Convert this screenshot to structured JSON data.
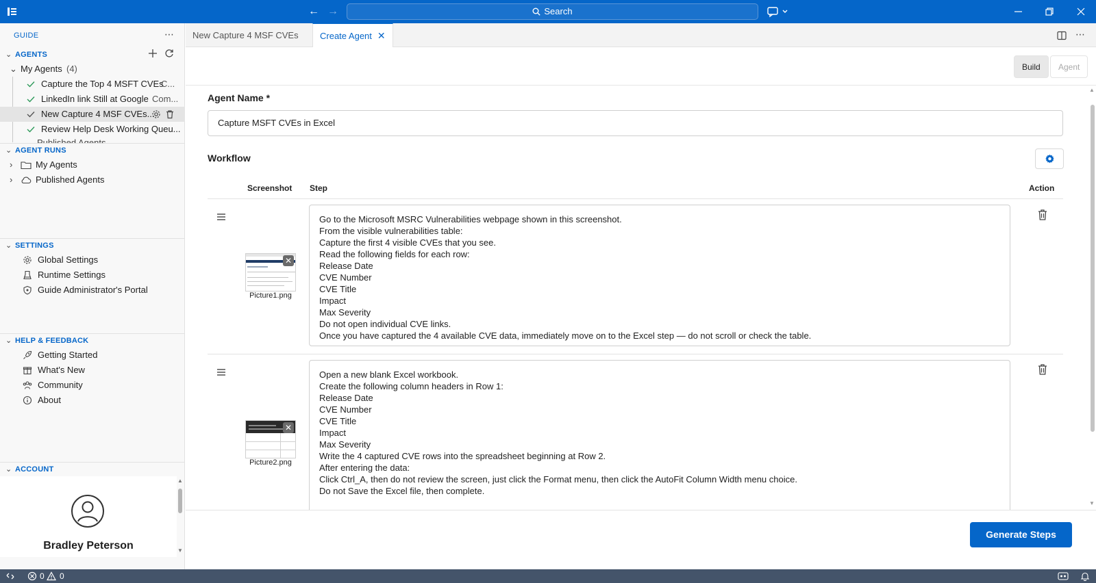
{
  "titlebar": {
    "search_label": "Search"
  },
  "sidebar": {
    "header": "GUIDE",
    "agents": {
      "title": "AGENTS",
      "my_agents_label": "My Agents",
      "my_agents_count": "(4)",
      "items": [
        {
          "label": "Capture the Top 4 MSFT CVEs",
          "suffix": "C..."
        },
        {
          "label": "LinkedIn link Still at Google",
          "suffix": "Com..."
        },
        {
          "label": "New Capture 4 MSF CVEs..."
        },
        {
          "label": "Review Help Desk Working Queu..."
        }
      ],
      "published_partial": "Published Agents"
    },
    "agent_runs": {
      "title": "AGENT RUNS",
      "items": [
        {
          "label": "My Agents"
        },
        {
          "label": "Published Agents"
        }
      ]
    },
    "settings": {
      "title": "SETTINGS",
      "items": [
        {
          "label": "Global Settings"
        },
        {
          "label": "Runtime Settings"
        },
        {
          "label": "Guide Administrator's Portal"
        }
      ]
    },
    "help": {
      "title": "HELP & FEEDBACK",
      "items": [
        {
          "label": "Getting Started"
        },
        {
          "label": "What's New"
        },
        {
          "label": "Community"
        },
        {
          "label": "About"
        }
      ]
    },
    "account": {
      "title": "ACCOUNT",
      "user_name": "Bradley Peterson"
    }
  },
  "tabs": [
    {
      "label": "New Capture 4 MSF CVEs"
    },
    {
      "label": "Create Agent"
    }
  ],
  "main": {
    "mode_build": "Build",
    "mode_agent": "Agent",
    "agent_name_label": "Agent Name *",
    "agent_name_value": "Capture MSFT CVEs in Excel",
    "workflow_label": "Workflow",
    "columns": {
      "screenshot": "Screenshot",
      "step": "Step",
      "action": "Action"
    },
    "steps": [
      {
        "screenshot": "Picture1.png",
        "text": "Go to the Microsoft MSRC Vulnerabilities webpage shown in this screenshot.\nFrom the visible vulnerabilities table:\nCapture the first 4 visible CVEs that you see.\nRead the following fields for each row:\nRelease Date\nCVE Number\nCVE Title\nImpact\nMax Severity\nDo not open individual CVE links.\nOnce you have captured the 4 available CVE data, immediately move on to the Excel step — do not scroll or check the table."
      },
      {
        "screenshot": "Picture2.png",
        "text": "Open a new blank Excel workbook.\nCreate the following column headers in Row 1:\nRelease Date\nCVE Number\nCVE Title\nImpact\nMax Severity\nWrite the 4 captured CVE rows into the spreadsheet beginning at Row 2.\nAfter entering the data:\nClick Ctrl_A, then do not review the screen, just click the Format menu, then click the AutoFit Column Width menu choice.\nDo not Save the Excel file, then complete."
      }
    ],
    "generate_label": "Generate Steps"
  },
  "statusbar": {
    "errors": "0",
    "warnings": "0"
  }
}
